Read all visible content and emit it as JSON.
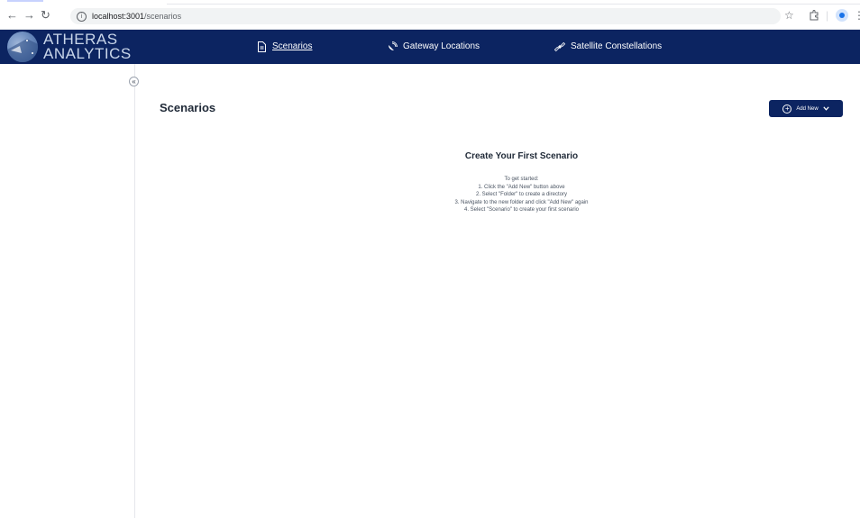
{
  "browser": {
    "url_host": "localhost:3001",
    "url_path": "/scenarios",
    "back_icon": "arrow-left-icon",
    "forward_icon": "arrow-right-icon",
    "reload_icon": "reload-icon",
    "bookmark_icon": "star-icon",
    "extensions_icon": "puzzle-icon",
    "menu_icon": "kebab-menu-icon"
  },
  "header": {
    "brand_line1": "ATHERAS",
    "brand_line2": "ANALYTICS",
    "nav": [
      {
        "label": "Scenarios",
        "icon": "document-icon",
        "active": true
      },
      {
        "label": "Gateway Locations",
        "icon": "satellite-dish-icon",
        "active": false
      },
      {
        "label": "Satellite Constellations",
        "icon": "satellite-icon",
        "active": false
      }
    ],
    "background_color": "#0c2461"
  },
  "sidebar": {
    "collapse_glyph": "«"
  },
  "main": {
    "title": "Scenarios",
    "add_new_label": "Add New",
    "empty_state": {
      "title": "Create Your First Scenario",
      "lines": [
        "To get started:",
        "1. Click the \"Add New\" button above",
        "2. Select \"Folder\" to create a directory",
        "3. Navigate to the new folder and click \"Add New\" again",
        "4. Select \"Scenario\" to create your first scenario"
      ]
    }
  }
}
